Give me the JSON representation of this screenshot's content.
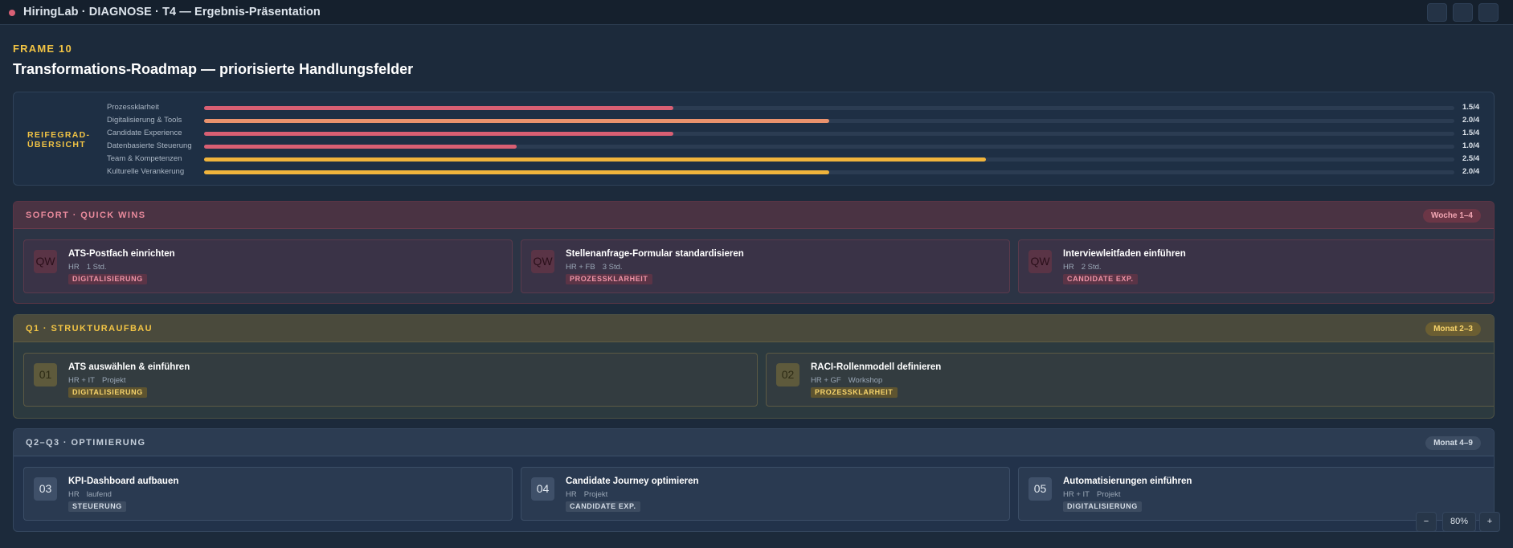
{
  "window": {
    "title": "HiringLab · DIAGNOSE · T4 — Ergebnis-Präsentation"
  },
  "frame": {
    "label": "FRAME 10",
    "title": "Transformations-Roadmap — priorisierte Handlungsfelder"
  },
  "maturity": {
    "label_line1": "REIFEGRAD-",
    "label_line2": "ÜBERSICHT",
    "max": 4,
    "rows": [
      {
        "label": "Prozessklarheit",
        "value": 1.5,
        "display": "1.5/4",
        "color": "#d95f73"
      },
      {
        "label": "Digitalisierung & Tools",
        "value": 2.0,
        "display": "2.0/4",
        "color": "#e9926d"
      },
      {
        "label": "Candidate Experience",
        "value": 1.5,
        "display": "1.5/4",
        "color": "#d95f73"
      },
      {
        "label": "Datenbasierte Steuerung",
        "value": 1.0,
        "display": "1.0/4",
        "color": "#d95f73"
      },
      {
        "label": "Team & Kompetenzen",
        "value": 2.5,
        "display": "2.5/4",
        "color": "#f0b43c"
      },
      {
        "label": "Kulturelle Verankerung",
        "value": 2.0,
        "display": "2.0/4",
        "color": "#f0b43c"
      }
    ]
  },
  "sections": {
    "quickwins": {
      "name": "SOFORT · QUICK WINS",
      "badge": "Woche 1–4",
      "cards": [
        {
          "num": "QW",
          "title": "ATS-Postfach einrichten",
          "owner": "HR",
          "effort": "1 Std.",
          "tag": "DIGITALISIERUNG"
        },
        {
          "num": "QW",
          "title": "Stellenanfrage-Formular standardisieren",
          "owner": "HR + FB",
          "effort": "3 Std.",
          "tag": "PROZESSKLARHEIT"
        },
        {
          "num": "QW",
          "title": "Interviewleitfaden einführen",
          "owner": "HR",
          "effort": "2 Std.",
          "tag": "CANDIDATE EXP."
        }
      ]
    },
    "q1": {
      "name": "Q1 · STRUKTURAUFBAU",
      "badge": "Monat 2–3",
      "cards": [
        {
          "num": "01",
          "title": "ATS auswählen & einführen",
          "owner": "HR + IT",
          "effort": "Projekt",
          "tag": "DIGITALISIERUNG"
        },
        {
          "num": "02",
          "title": "RACI-Rollenmodell definieren",
          "owner": "HR + GF",
          "effort": "Workshop",
          "tag": "PROZESSKLARHEIT"
        }
      ]
    },
    "q2q3": {
      "name": "Q2–Q3 · OPTIMIERUNG",
      "badge": "Monat 4–9",
      "cards": [
        {
          "num": "03",
          "title": "KPI-Dashboard aufbauen",
          "owner": "HR",
          "effort": "laufend",
          "tag": "STEUERUNG"
        },
        {
          "num": "04",
          "title": "Candidate Journey optimieren",
          "owner": "HR",
          "effort": "Projekt",
          "tag": "CANDIDATE EXP."
        },
        {
          "num": "05",
          "title": "Automatisierungen einführen",
          "owner": "HR + IT",
          "effort": "Projekt",
          "tag": "DIGITALISIERUNG"
        }
      ]
    }
  },
  "zoom": {
    "minus": "−",
    "level": "80%",
    "plus": "+"
  }
}
